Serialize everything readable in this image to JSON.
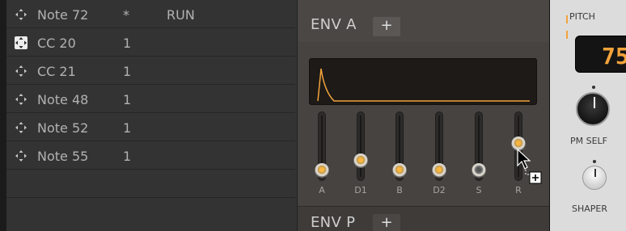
{
  "notes_list": {
    "rows": [
      {
        "name": "Note 72",
        "value": "*",
        "extra": "RUN"
      },
      {
        "name": "CC 20",
        "value": "1",
        "extra": ""
      },
      {
        "name": "CC 21",
        "value": "1",
        "extra": ""
      },
      {
        "name": "Note 48",
        "value": "1",
        "extra": ""
      },
      {
        "name": "Note 52",
        "value": "1",
        "extra": ""
      },
      {
        "name": "Note 55",
        "value": "1",
        "extra": ""
      }
    ],
    "icon": "move-arrows-icon"
  },
  "env_a": {
    "title": "ENV A",
    "add_label": "+",
    "sliders": [
      {
        "label": "A",
        "level": 0.0
      },
      {
        "label": "D1",
        "level": 0.2
      },
      {
        "label": "B",
        "level": 0.0
      },
      {
        "label": "D2",
        "level": 0.0
      },
      {
        "label": "S",
        "level": 0.0
      },
      {
        "label": "R",
        "level": 0.55
      }
    ],
    "accent_color": "#f2a33b"
  },
  "env_p": {
    "title": "ENV P",
    "add_label": "+"
  },
  "pitch": {
    "title": "PITCH",
    "readout": "75",
    "pm_self_label": "PM SELF",
    "shaper_label": "SHAPER"
  },
  "cursor": {
    "icon": "drag-copy-cursor-icon"
  }
}
